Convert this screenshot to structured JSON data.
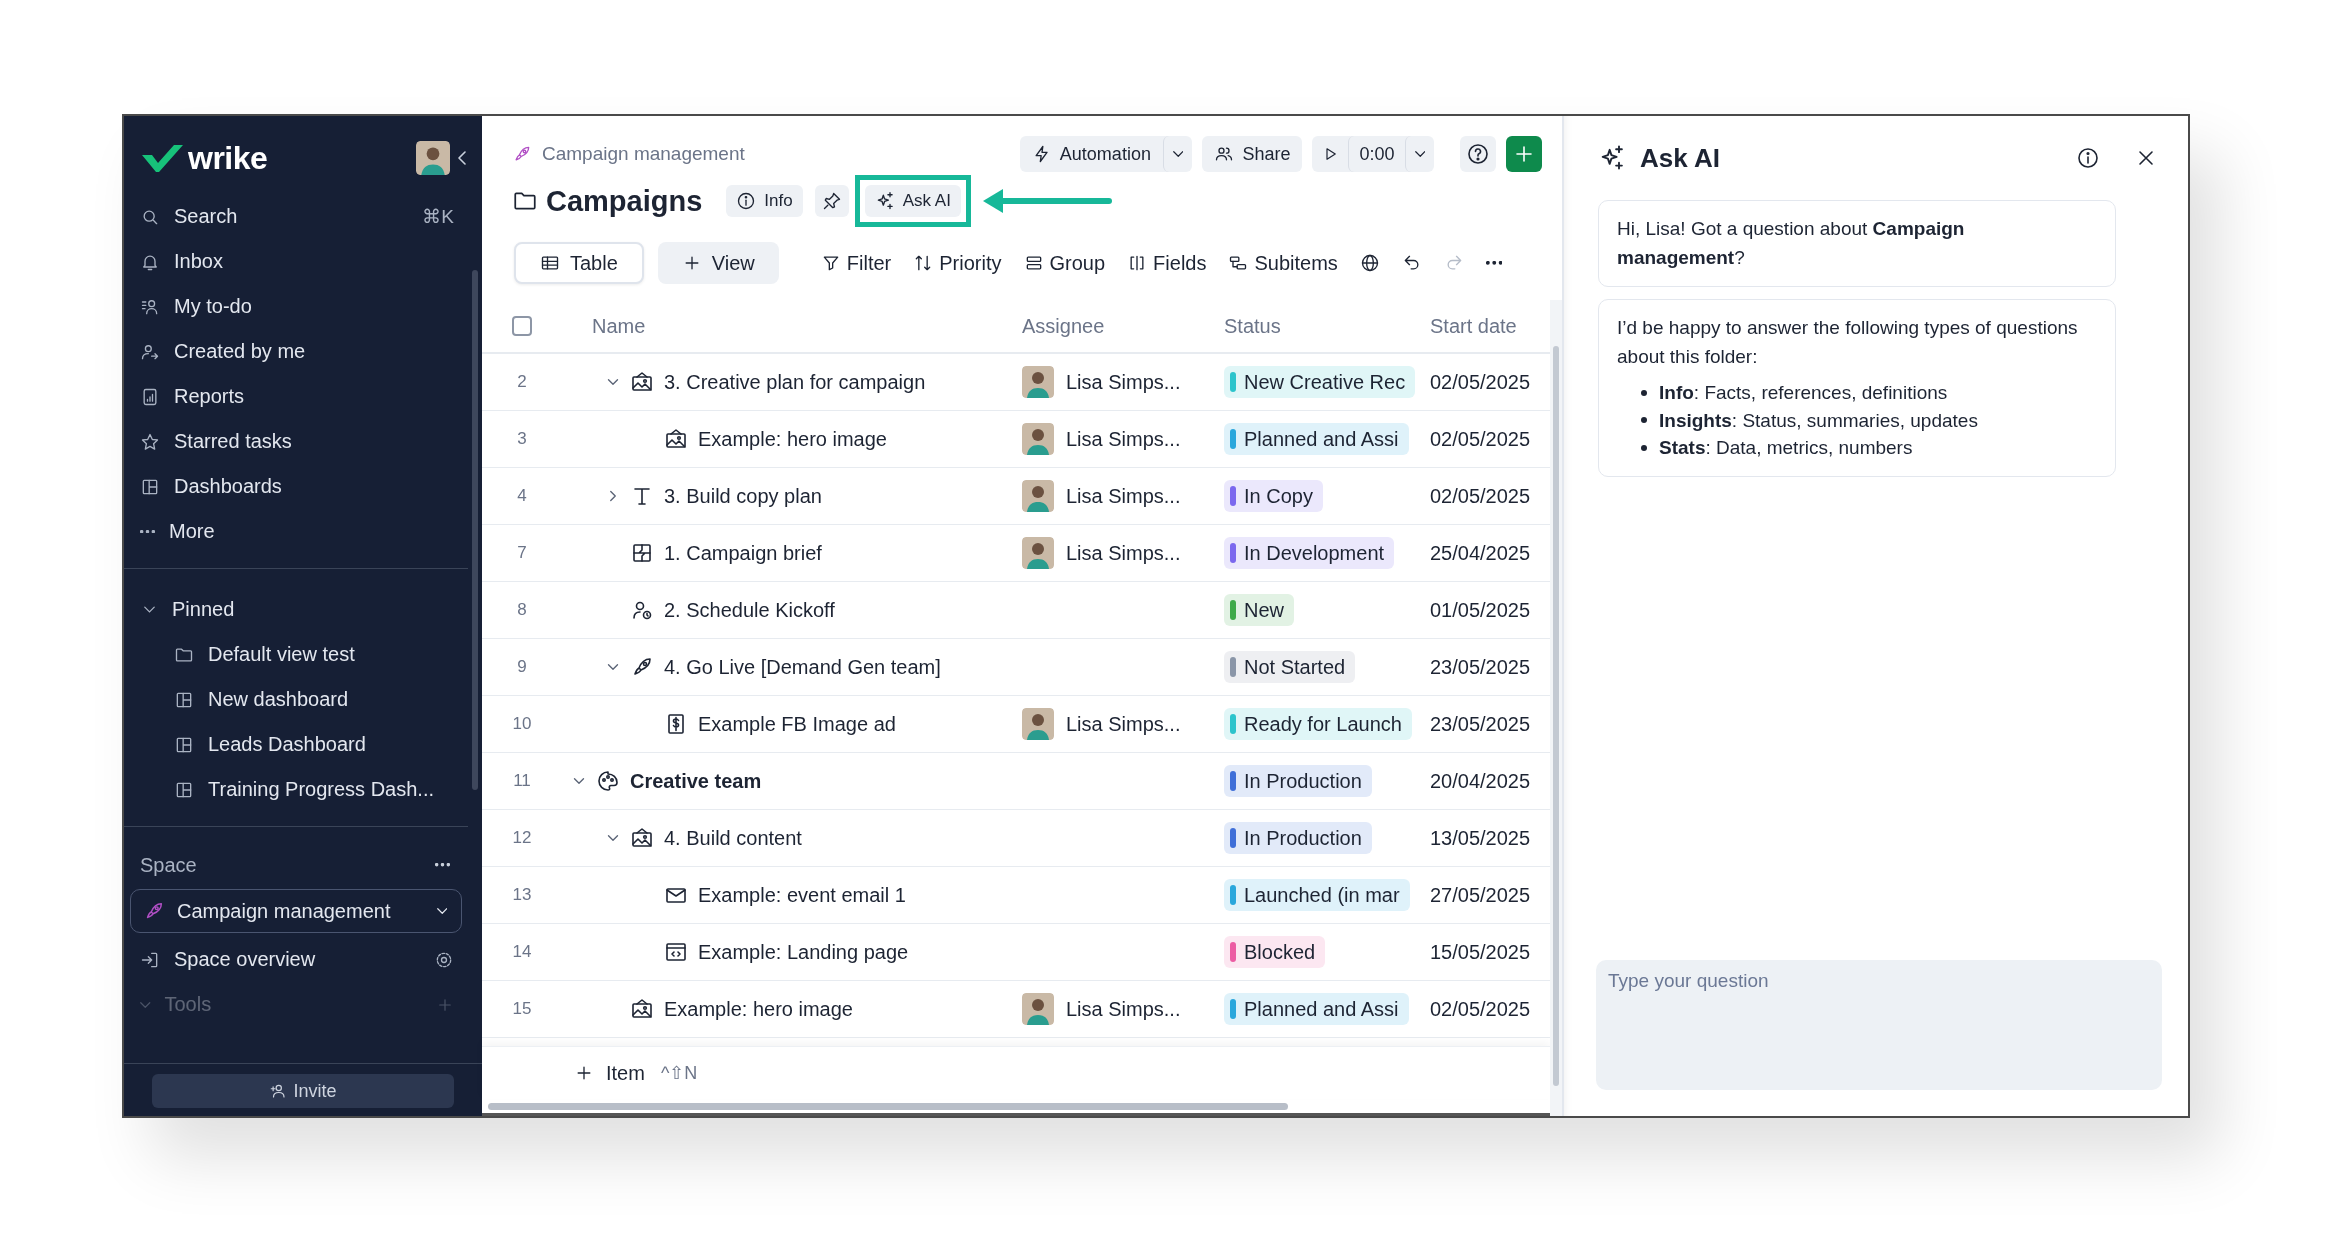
{
  "sidebar": {
    "logo": "wrike",
    "nav": [
      {
        "label": "Search",
        "kind": "search",
        "shortcut": "⌘K"
      },
      {
        "label": "Inbox",
        "kind": "inbox"
      },
      {
        "label": "My to-do",
        "kind": "todo"
      },
      {
        "label": "Created by me",
        "kind": "created"
      },
      {
        "label": "Reports",
        "kind": "reports"
      },
      {
        "label": "Starred tasks",
        "kind": "starred"
      },
      {
        "label": "Dashboards",
        "kind": "dashboard"
      },
      {
        "label": "More",
        "kind": "more"
      }
    ],
    "pinned": {
      "title": "Pinned",
      "expanded": true,
      "items": [
        {
          "label": "Default view test",
          "kind": "folder"
        },
        {
          "label": "New dashboard",
          "kind": "dashboard"
        },
        {
          "label": "Leads Dashboard",
          "kind": "dashboard"
        },
        {
          "label": "Training Progress Dash...",
          "kind": "dashboard"
        }
      ]
    },
    "space": {
      "title": "Space",
      "selector": "Campaign management",
      "overview": "Space overview",
      "tools": "Tools"
    },
    "invite": "Invite"
  },
  "header": {
    "breadcrumb": "Campaign management",
    "automation": "Automation",
    "share": "Share",
    "timer": "0:00",
    "title": "Campaigns",
    "info": "Info",
    "ask_ai": "Ask AI",
    "ask_ai_highlighted": true
  },
  "toolbar": {
    "views": [
      {
        "label": "Table",
        "selected": true
      }
    ],
    "add_view": "View",
    "tools": [
      {
        "label": "Filter",
        "kind": "filter"
      },
      {
        "label": "Priority",
        "kind": "priority"
      },
      {
        "label": "Group",
        "kind": "group"
      },
      {
        "label": "Fields",
        "kind": "fields"
      },
      {
        "label": "Subitems",
        "kind": "subitems"
      }
    ]
  },
  "table": {
    "select_all_checked": false,
    "columns": [
      "Name",
      "Assignee",
      "Status",
      "Start date"
    ],
    "rows": [
      {
        "number": "2",
        "name": "3. Creative plan for campaign",
        "kind": "image",
        "expanded": true,
        "assignee": "Lisa Simps...",
        "status": "New Creative Rec",
        "color": "#2cc4cc",
        "start_date": "02/05/2025",
        "children": [
          {
            "number": "3",
            "name": "Example: hero image",
            "kind": "image",
            "assignee": "Lisa Simps...",
            "status": "Planned and Assi",
            "color": "#2aa7dc",
            "start_date": "02/05/2025"
          }
        ]
      },
      {
        "number": "4",
        "name": "3. Build copy plan",
        "kind": "copy",
        "expanded": false,
        "assignee": "Lisa Simps...",
        "status": "In Copy",
        "color": "#7b68ee",
        "start_date": "02/05/2025"
      },
      {
        "number": "7",
        "name": "1. Campaign brief",
        "kind": "brief",
        "assignee": "Lisa Simps...",
        "status": "In Development",
        "color": "#7b68ee",
        "start_date": "25/04/2025"
      },
      {
        "number": "8",
        "name": "2. Schedule Kickoff",
        "kind": "meeting",
        "status": "New",
        "color": "#3faa4a",
        "start_date": "01/05/2025"
      },
      {
        "number": "9",
        "name": "4. Go Live [Demand Gen team]",
        "kind": "launch",
        "expanded": true,
        "status": "Not Started",
        "color": "#8a96a8",
        "start_date": "23/05/2025",
        "children": [
          {
            "number": "10",
            "name": "Example FB Image ad",
            "kind": "ad",
            "assignee": "Lisa Simps...",
            "status": "Ready for Launch",
            "color": "#2cc4cc",
            "start_date": "23/05/2025"
          }
        ]
      },
      {
        "number": "11",
        "name": "Creative team",
        "kind": "team",
        "expanded": true,
        "status": "In Production",
        "color": "#3f6fd8",
        "start_date": "20/04/2025",
        "children": [
          {
            "number": "12",
            "name": "4. Build content",
            "kind": "image",
            "expanded": true,
            "status": "In Production",
            "color": "#3f6fd8",
            "start_date": "13/05/2025",
            "children": [
              {
                "number": "13",
                "name": "Example: event email 1",
                "kind": "email",
                "status": "Launched (in mar",
                "color": "#2aa7dc",
                "start_date": "27/05/2025"
              },
              {
                "number": "14",
                "name": "Example: Landing page",
                "kind": "web",
                "status": "Blocked",
                "color": "#ec5ca3",
                "start_date": "15/05/2025"
              }
            ]
          },
          {
            "number": "15",
            "name": "Example: hero image",
            "kind": "image",
            "assignee": "Lisa Simps...",
            "status": "Planned and Assi",
            "color": "#2aa7dc",
            "start_date": "02/05/2025"
          }
        ]
      }
    ],
    "add_item": "Item",
    "add_item_shortcut": "^⇧N"
  },
  "ai_panel": {
    "title": "Ask AI",
    "messages": [
      {
        "text": "Hi, Lisa! Got a question about **Campaign management**?"
      },
      {
        "text": "I’d be happy to answer the following types of questions about this folder:",
        "bullets": [
          "**Info**: Facts, references, definitions",
          "**Insights**: Status, summaries, updates",
          "**Stats**: Data, metrics, numbers"
        ]
      }
    ],
    "input": {
      "placeholder": "Type your question"
    }
  }
}
